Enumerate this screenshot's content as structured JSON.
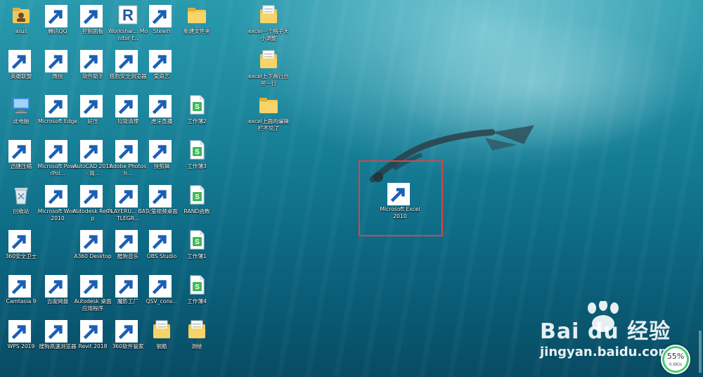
{
  "desktop": {
    "icons": [
      {
        "label": "asus",
        "icon": "user-folder-icon",
        "col": 0,
        "row": 0,
        "shortcut": false
      },
      {
        "label": "英雄联盟",
        "icon": "league-icon",
        "col": 0,
        "row": 1,
        "shortcut": true
      },
      {
        "label": "此电脑",
        "icon": "computer-icon",
        "col": 0,
        "row": 2,
        "shortcut": false
      },
      {
        "label": "迅捷压缩",
        "icon": "zip-icon",
        "col": 0,
        "row": 3,
        "shortcut": true
      },
      {
        "label": "回收站",
        "icon": "recycle-bin-icon",
        "col": 0,
        "row": 4,
        "shortcut": false
      },
      {
        "label": "360安全卫士",
        "icon": "shield-plus-icon",
        "col": 0,
        "row": 5,
        "shortcut": true
      },
      {
        "label": "Camtasia 9",
        "icon": "camtasia-icon",
        "col": 0,
        "row": 6,
        "shortcut": true
      },
      {
        "label": "WPS 2019",
        "icon": "wps-icon",
        "col": 0,
        "row": 7,
        "shortcut": true
      },
      {
        "label": "腾讯QQ",
        "icon": "qq-penguin-icon",
        "col": 1,
        "row": 0,
        "shortcut": true
      },
      {
        "label": "微信",
        "icon": "wechat-icon",
        "col": 1,
        "row": 1,
        "shortcut": true
      },
      {
        "label": "Microsoft Edge",
        "icon": "edge-icon",
        "col": 1,
        "row": 2,
        "shortcut": true
      },
      {
        "label": "Microsoft PowerPoi...",
        "icon": "powerpoint-icon",
        "col": 1,
        "row": 3,
        "shortcut": true
      },
      {
        "label": "Microsoft Word 2010",
        "icon": "word-icon",
        "col": 1,
        "row": 4,
        "shortcut": true
      },
      {
        "label": "百度网盘",
        "icon": "baidu-pan-icon",
        "col": 1,
        "row": 6,
        "shortcut": true
      },
      {
        "label": "搜狗高速浏览器",
        "icon": "sogou-icon",
        "col": 1,
        "row": 7,
        "shortcut": true
      },
      {
        "label": "控制面板",
        "icon": "control-panel-icon",
        "col": 2,
        "row": 0,
        "shortcut": true
      },
      {
        "label": "软件助手",
        "icon": "apps-grid-icon",
        "col": 2,
        "row": 1,
        "shortcut": true
      },
      {
        "label": "好压",
        "icon": "haozip-icon",
        "col": 2,
        "row": 2,
        "shortcut": true
      },
      {
        "label": "AutoCAD 2018 - 简...",
        "icon": "autocad-icon",
        "col": 2,
        "row": 3,
        "shortcut": true
      },
      {
        "label": "Autodesk ReCap",
        "icon": "recap-icon",
        "col": 2,
        "row": 4,
        "shortcut": true
      },
      {
        "label": "A360 Desktop",
        "icon": "a360-icon",
        "col": 2,
        "row": 5,
        "shortcut": true
      },
      {
        "label": "Autodesk 桌面应用程序",
        "icon": "autodesk-icon",
        "col": 2,
        "row": 6,
        "shortcut": true
      },
      {
        "label": "Revit 2018",
        "icon": "revit-icon",
        "col": 2,
        "row": 7,
        "shortcut": true
      },
      {
        "label": "Workshar... Monitor f...",
        "icon": "revit-icon",
        "col": 3,
        "row": 0,
        "shortcut": false
      },
      {
        "label": "猎豹安全浏览器",
        "icon": "liebao-icon",
        "col": 3,
        "row": 1,
        "shortcut": true
      },
      {
        "label": "垃圾清理",
        "icon": "cleaner-icon",
        "col": 3,
        "row": 2,
        "shortcut": true
      },
      {
        "label": "Adobe Photosh...",
        "icon": "photoshop-icon",
        "col": 3,
        "row": 3,
        "shortcut": true
      },
      {
        "label": "PLAYERU... BATTLEGR...",
        "icon": "pubg-icon",
        "col": 3,
        "row": 4,
        "shortcut": true
      },
      {
        "label": "酷狗音乐",
        "icon": "kugou-icon",
        "col": 3,
        "row": 5,
        "shortcut": true
      },
      {
        "label": "魔影工厂",
        "icon": "moying-icon",
        "col": 3,
        "row": 6,
        "shortcut": true
      },
      {
        "label": "360软件管家",
        "icon": "360-manager-icon",
        "col": 3,
        "row": 7,
        "shortcut": true
      },
      {
        "label": "Steam",
        "icon": "steam-icon",
        "col": 4,
        "row": 0,
        "shortcut": true
      },
      {
        "label": "爱奇艺",
        "icon": "iqiyi-icon",
        "col": 4,
        "row": 1,
        "shortcut": true
      },
      {
        "label": "虎牙直播",
        "icon": "huya-icon",
        "col": 4,
        "row": 2,
        "shortcut": true
      },
      {
        "label": "快剪辑",
        "icon": "kuaijianji-icon",
        "col": 4,
        "row": 3,
        "shortcut": true
      },
      {
        "label": "火萤视频桌面",
        "icon": "huoying-icon",
        "col": 4,
        "row": 4,
        "shortcut": true
      },
      {
        "label": "OBS Studio",
        "icon": "obs-icon",
        "col": 4,
        "row": 5,
        "shortcut": true
      },
      {
        "label": "QSV_conv...",
        "icon": "winrar-icon",
        "col": 4,
        "row": 6,
        "shortcut": true
      },
      {
        "label": "钢筋",
        "icon": "file-folder-icon",
        "col": 4,
        "row": 7,
        "shortcut": false
      },
      {
        "label": "新建文件夹",
        "icon": "folder-icon",
        "col": 5,
        "row": 0,
        "shortcut": false
      },
      {
        "label": "工作薄2",
        "icon": "sheet-doc-icon",
        "col": 5,
        "row": 2,
        "shortcut": false
      },
      {
        "label": "工作薄3",
        "icon": "sheet-doc-icon",
        "col": 5,
        "row": 3,
        "shortcut": false
      },
      {
        "label": "RAND函数",
        "icon": "sheet-doc-icon",
        "col": 5,
        "row": 4,
        "shortcut": false
      },
      {
        "label": "工作薄1",
        "icon": "sheet-doc-icon",
        "col": 5,
        "row": 5,
        "shortcut": false
      },
      {
        "label": "工作薄4",
        "icon": "sheet-doc-icon",
        "col": 5,
        "row": 6,
        "shortcut": false
      },
      {
        "label": "测绘",
        "icon": "file-folder-icon",
        "col": 5,
        "row": 7,
        "shortcut": false
      },
      {
        "label": "excel一个格子大小调整",
        "icon": "file-folder-icon",
        "col": 7,
        "row": 0,
        "shortcut": false
      },
      {
        "label": "excel上下两行合并一行",
        "icon": "file-folder-icon",
        "col": 7,
        "row": 1,
        "shortcut": false
      },
      {
        "label": "excel上面的编辑栏不见了",
        "icon": "folder-icon",
        "col": 7,
        "row": 2,
        "shortcut": false
      }
    ],
    "selected_icon": {
      "label": "Microsoft Excel 2010",
      "icon": "excel-icon",
      "shortcut": true
    }
  },
  "watermark": {
    "logo": "Bai du 经验",
    "url": "jingyan.baidu.com"
  },
  "net_meter": {
    "percent": "55%",
    "speed": "0.6K/s"
  },
  "colors": {
    "excel_green": "#1d7a3c",
    "selection_border": "#d84444",
    "meter_ring": "#49c97b"
  }
}
